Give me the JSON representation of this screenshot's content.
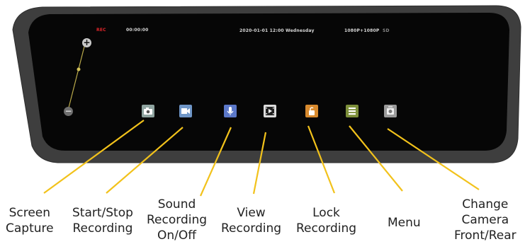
{
  "screen": {
    "rec_label": "REC",
    "timer": "00:00:00",
    "datetime": "2020-01-01 12:00 Wednesday",
    "resolution": "1080P+1080P",
    "sd_indicator": "SD"
  },
  "zoom": {
    "plus_symbol": "+",
    "minus_symbol": "−",
    "level": 0.5
  },
  "toolbar": [
    {
      "id": "screen-capture",
      "icon": "camera-icon",
      "color": "#8fa4a0"
    },
    {
      "id": "start-stop-recording",
      "icon": "video-camera-icon",
      "color": "#6f96c7"
    },
    {
      "id": "sound-recording",
      "icon": "microphone-icon",
      "color": "#5b78c9"
    },
    {
      "id": "view-recording",
      "icon": "film-play-icon",
      "color": "#dcdcdc"
    },
    {
      "id": "lock-recording",
      "icon": "unlock-icon",
      "color": "#d88a2e"
    },
    {
      "id": "menu",
      "icon": "menu-list-icon",
      "color": "#7d8f3a"
    },
    {
      "id": "change-camera",
      "icon": "camera-switch-icon",
      "color": "#9a9a9a"
    }
  ],
  "labels": {
    "screen_capture": [
      "Screen",
      "Capture"
    ],
    "start_stop": [
      "Start/Stop",
      "Recording"
    ],
    "sound_recording": [
      "Sound",
      "Recording",
      "On/Off"
    ],
    "view_recording": [
      "View",
      "Recording"
    ],
    "lock_recording": [
      "Lock",
      "Recording"
    ],
    "menu": [
      "Menu"
    ],
    "change_camera": [
      "Change",
      "Camera",
      "Front/Rear"
    ]
  },
  "colors": {
    "bezel": "#3e3e3e",
    "screen": "#060606",
    "callout_line": "#f2c21b"
  }
}
